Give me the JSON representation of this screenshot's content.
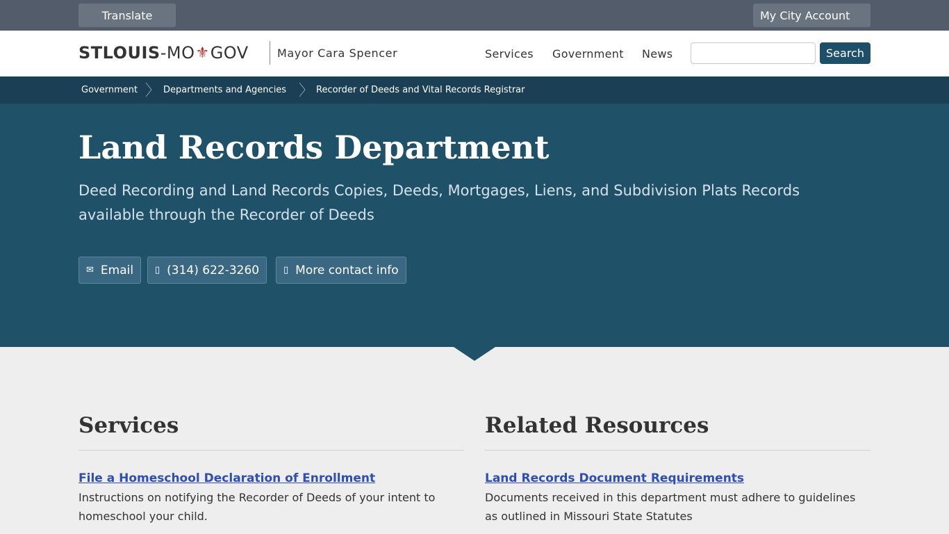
{
  "topbar": {
    "translate_label": "Translate",
    "account_label": "My City Account"
  },
  "header": {
    "logo_part1": "STLOUIS",
    "logo_part2": "-MO",
    "logo_part3": "GOV",
    "logo_fleur": "⚜",
    "mayor": "Mayor Cara Spencer",
    "nav": [
      "Services",
      "Government",
      "News"
    ],
    "search_value": "",
    "search_button": "Search"
  },
  "breadcrumb": [
    "Government",
    "Departments and Agencies",
    "Recorder of Deeds and Vital Records Registrar"
  ],
  "hero": {
    "title": "Land Records Department",
    "subtitle": "Deed Recording and Land Records Copies, Deeds, Mortgages, Liens, and Subdivision Plats Records available through the Recorder of Deeds",
    "contacts": [
      {
        "icon": "envelope-icon",
        "glyph": "✉",
        "label": "Email"
      },
      {
        "icon": "phone-icon",
        "glyph": "▯",
        "label": "(314) 622-3260"
      },
      {
        "icon": "info-icon",
        "glyph": "▯",
        "label": "More contact info"
      }
    ]
  },
  "services": {
    "title": "Services",
    "items": [
      {
        "link": "File a Homeschool Declaration of Enrollment",
        "desc": "Instructions on notifying the Recorder of Deeds of your intent to homeschool your child."
      }
    ]
  },
  "resources": {
    "title": "Related Resources",
    "items": [
      {
        "link": "Land Records Document Requirements",
        "desc": "Documents received in this department must adhere to guidelines as outlined in Missouri State Statutes"
      }
    ]
  },
  "colors": {
    "topbar": "#535c6a",
    "hero": "#1f5169",
    "breadcrumb": "#1b3f55",
    "link": "#2d4fb0",
    "fleur": "#b3322c"
  }
}
